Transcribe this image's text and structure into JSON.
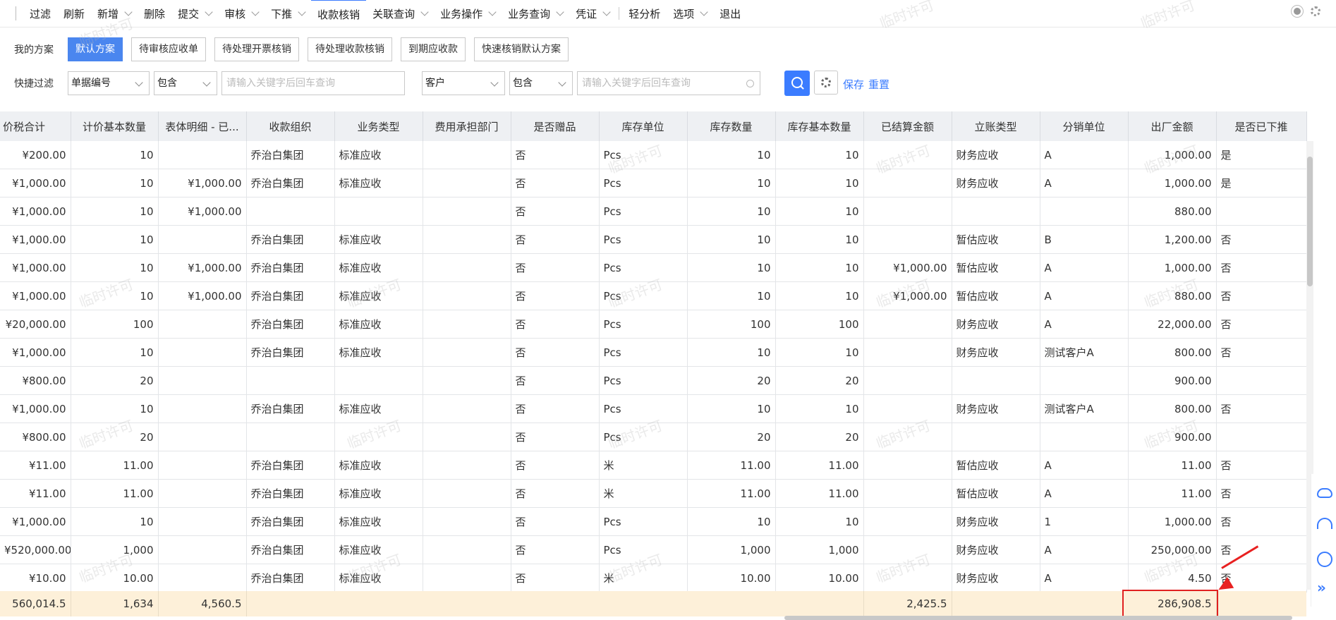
{
  "toolbar": {
    "items": [
      {
        "label": "过滤",
        "caret": false
      },
      {
        "label": "刷新",
        "caret": false
      },
      {
        "label": "新增",
        "caret": true
      },
      {
        "label": "删除",
        "caret": false
      },
      {
        "label": "提交",
        "caret": true
      },
      {
        "label": "审核",
        "caret": true
      },
      {
        "label": "下推",
        "caret": true
      },
      {
        "label": "收款核销",
        "caret": false
      },
      {
        "label": "关联查询",
        "caret": true
      },
      {
        "label": "业务操作",
        "caret": true
      },
      {
        "label": "业务查询",
        "caret": true
      },
      {
        "label": "凭证",
        "caret": true
      },
      {
        "label": "轻分析",
        "caret": false
      },
      {
        "label": "选项",
        "caret": true
      },
      {
        "label": "退出",
        "caret": false
      }
    ]
  },
  "schemes": {
    "label": "我的方案",
    "buttons": [
      "默认方案",
      "待审核应收单",
      "待处理开票核销",
      "待处理收款核销",
      "到期应收款",
      "快速核销默认方案"
    ]
  },
  "quick_filter": {
    "label": "快捷过滤",
    "field1": "单据编号",
    "op1": "包含",
    "input1_placeholder": "请输入关键字后回车查询",
    "field2": "客户",
    "op2": "包含",
    "input2_placeholder": "请输入关键字后回车查询",
    "save": "保存",
    "reset": "重置"
  },
  "grid": {
    "columns": [
      "价税合计",
      "计价基本数量",
      "表体明细 - 已...",
      "收款组织",
      "业务类型",
      "费用承担部门",
      "是否赠品",
      "库存单位",
      "库存数量",
      "库存基本数量",
      "已结算金额",
      "立账类型",
      "分销单位",
      "出厂金额",
      "是否已下推"
    ],
    "rows": [
      [
        "¥200.00",
        "10",
        "",
        "乔治白集团",
        "标准应收",
        "",
        "否",
        "Pcs",
        "10",
        "10",
        "",
        "财务应收",
        "A",
        "1,000.00",
        "是"
      ],
      [
        "¥1,000.00",
        "10",
        "¥1,000.00",
        "乔治白集团",
        "标准应收",
        "",
        "否",
        "Pcs",
        "10",
        "10",
        "",
        "财务应收",
        "A",
        "1,000.00",
        "是"
      ],
      [
        "¥1,000.00",
        "10",
        "¥1,000.00",
        "",
        "",
        "",
        "否",
        "Pcs",
        "10",
        "10",
        "",
        "",
        "",
        "880.00",
        ""
      ],
      [
        "¥1,000.00",
        "10",
        "",
        "乔治白集团",
        "标准应收",
        "",
        "否",
        "Pcs",
        "10",
        "10",
        "",
        "暂估应收",
        "B",
        "1,200.00",
        "否"
      ],
      [
        "¥1,000.00",
        "10",
        "¥1,000.00",
        "乔治白集团",
        "标准应收",
        "",
        "否",
        "Pcs",
        "10",
        "10",
        "¥1,000.00",
        "暂估应收",
        "A",
        "1,000.00",
        "否"
      ],
      [
        "¥1,000.00",
        "10",
        "¥1,000.00",
        "乔治白集团",
        "标准应收",
        "",
        "否",
        "Pcs",
        "10",
        "10",
        "¥1,000.00",
        "暂估应收",
        "A",
        "880.00",
        "否"
      ],
      [
        "¥20,000.00",
        "100",
        "",
        "乔治白集团",
        "标准应收",
        "",
        "否",
        "Pcs",
        "100",
        "100",
        "",
        "财务应收",
        "A",
        "22,000.00",
        "否"
      ],
      [
        "¥1,000.00",
        "10",
        "",
        "乔治白集团",
        "标准应收",
        "",
        "否",
        "Pcs",
        "10",
        "10",
        "",
        "财务应收",
        "测试客户A",
        "800.00",
        "否"
      ],
      [
        "¥800.00",
        "20",
        "",
        "",
        "",
        "",
        "否",
        "Pcs",
        "20",
        "20",
        "",
        "",
        "",
        "900.00",
        ""
      ],
      [
        "¥1,000.00",
        "10",
        "",
        "乔治白集团",
        "标准应收",
        "",
        "否",
        "Pcs",
        "10",
        "10",
        "",
        "财务应收",
        "测试客户A",
        "800.00",
        "否"
      ],
      [
        "¥800.00",
        "20",
        "",
        "",
        "",
        "",
        "否",
        "Pcs",
        "20",
        "20",
        "",
        "",
        "",
        "900.00",
        ""
      ],
      [
        "¥11.00",
        "11.00",
        "",
        "乔治白集团",
        "标准应收",
        "",
        "否",
        "米",
        "11.00",
        "11.00",
        "",
        "暂估应收",
        "A",
        "11.00",
        "否"
      ],
      [
        "¥11.00",
        "11.00",
        "",
        "乔治白集团",
        "标准应收",
        "",
        "否",
        "米",
        "11.00",
        "11.00",
        "",
        "暂估应收",
        "A",
        "11.00",
        "否"
      ],
      [
        "¥1,000.00",
        "10",
        "",
        "乔治白集团",
        "标准应收",
        "",
        "否",
        "Pcs",
        "10",
        "10",
        "",
        "财务应收",
        "1",
        "1,000.00",
        "否"
      ],
      [
        "¥520,000.00",
        "1,000",
        "",
        "乔治白集团",
        "标准应收",
        "",
        "否",
        "Pcs",
        "1,000",
        "1,000",
        "",
        "财务应收",
        "A",
        "250,000.00",
        "否"
      ],
      [
        "¥10.00",
        "10.00",
        "",
        "乔治白集团",
        "标准应收",
        "",
        "否",
        "米",
        "10.00",
        "10.00",
        "",
        "财务应收",
        "A",
        "4.50",
        "否"
      ]
    ],
    "totals": [
      "560,014.5",
      "1,634",
      "4,560.5",
      "",
      "",
      "",
      "",
      "",
      "",
      "",
      "2,425.5",
      "",
      "",
      "286,908.5",
      ""
    ]
  },
  "watermark": "临时许可"
}
